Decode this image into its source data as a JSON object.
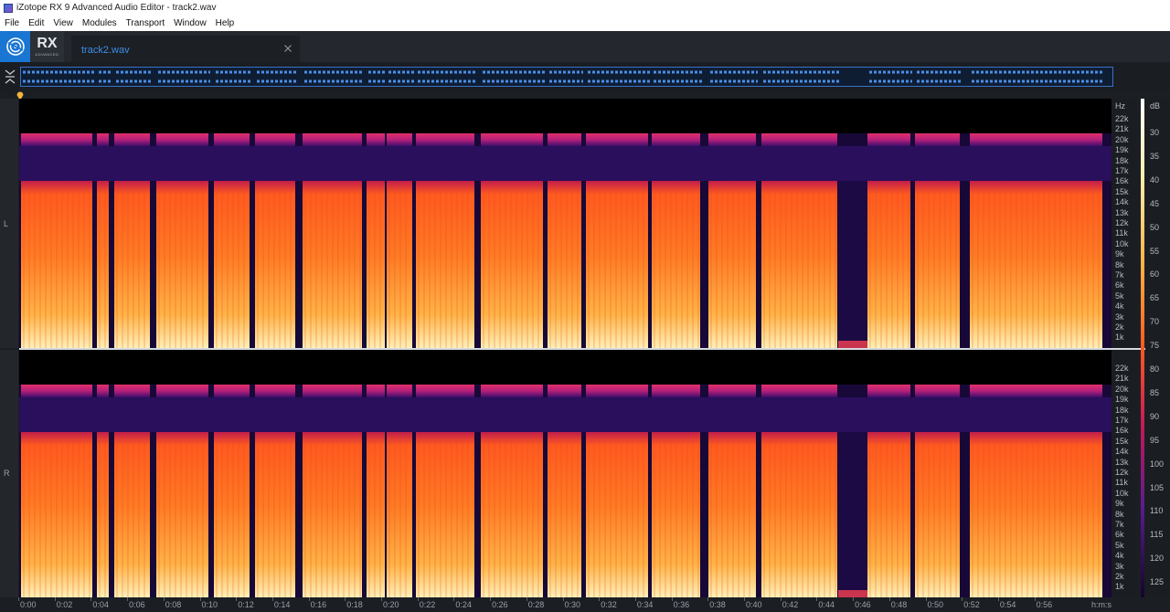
{
  "window": {
    "title": "iZotope RX 9 Advanced Audio Editor - track2.wav"
  },
  "menu": [
    "File",
    "Edit",
    "View",
    "Modules",
    "Transport",
    "Window",
    "Help"
  ],
  "branding": {
    "product": "RX",
    "edition": "ADVANCED"
  },
  "tabs": [
    {
      "label": "track2.wav",
      "active": true
    }
  ],
  "channels": [
    {
      "label": "L"
    },
    {
      "label": "R"
    }
  ],
  "hz_scale": {
    "unit": "Hz",
    "ticks": [
      "22k",
      "21k",
      "20k",
      "19k",
      "18k",
      "17k",
      "16k",
      "15k",
      "14k",
      "13k",
      "12k",
      "11k",
      "10k",
      "9k",
      "8k",
      "7k",
      "6k",
      "5k",
      "4k",
      "3k",
      "2k",
      "1k"
    ]
  },
  "db_scale": {
    "unit": "dB",
    "ticks": [
      "30",
      "35",
      "40",
      "45",
      "50",
      "55",
      "60",
      "65",
      "70",
      "75",
      "80",
      "85",
      "90",
      "95",
      "100",
      "105",
      "110",
      "115",
      "120",
      "125"
    ]
  },
  "timeline": {
    "unit": "h:m:s",
    "ticks": [
      "0:00",
      "0:02",
      "0:04",
      "0:06",
      "0:08",
      "0:10",
      "0:12",
      "0:14",
      "0:16",
      "0:18",
      "0:20",
      "0:22",
      "0:24",
      "0:26",
      "0:28",
      "0:30",
      "0:32",
      "0:34",
      "0:36",
      "0:38",
      "0:40",
      "0:42",
      "0:44",
      "0:46",
      "0:48",
      "0:50",
      "0:52",
      "0:54",
      "0:56"
    ]
  },
  "colors": {
    "accent": "#1976d2",
    "tab_text": "#3d8ee8",
    "waveform": "#3a72c7",
    "spec_hot": "#ffe9a8",
    "spec_mid": "#ff6a1f",
    "spec_low": "#5b1b8f"
  }
}
